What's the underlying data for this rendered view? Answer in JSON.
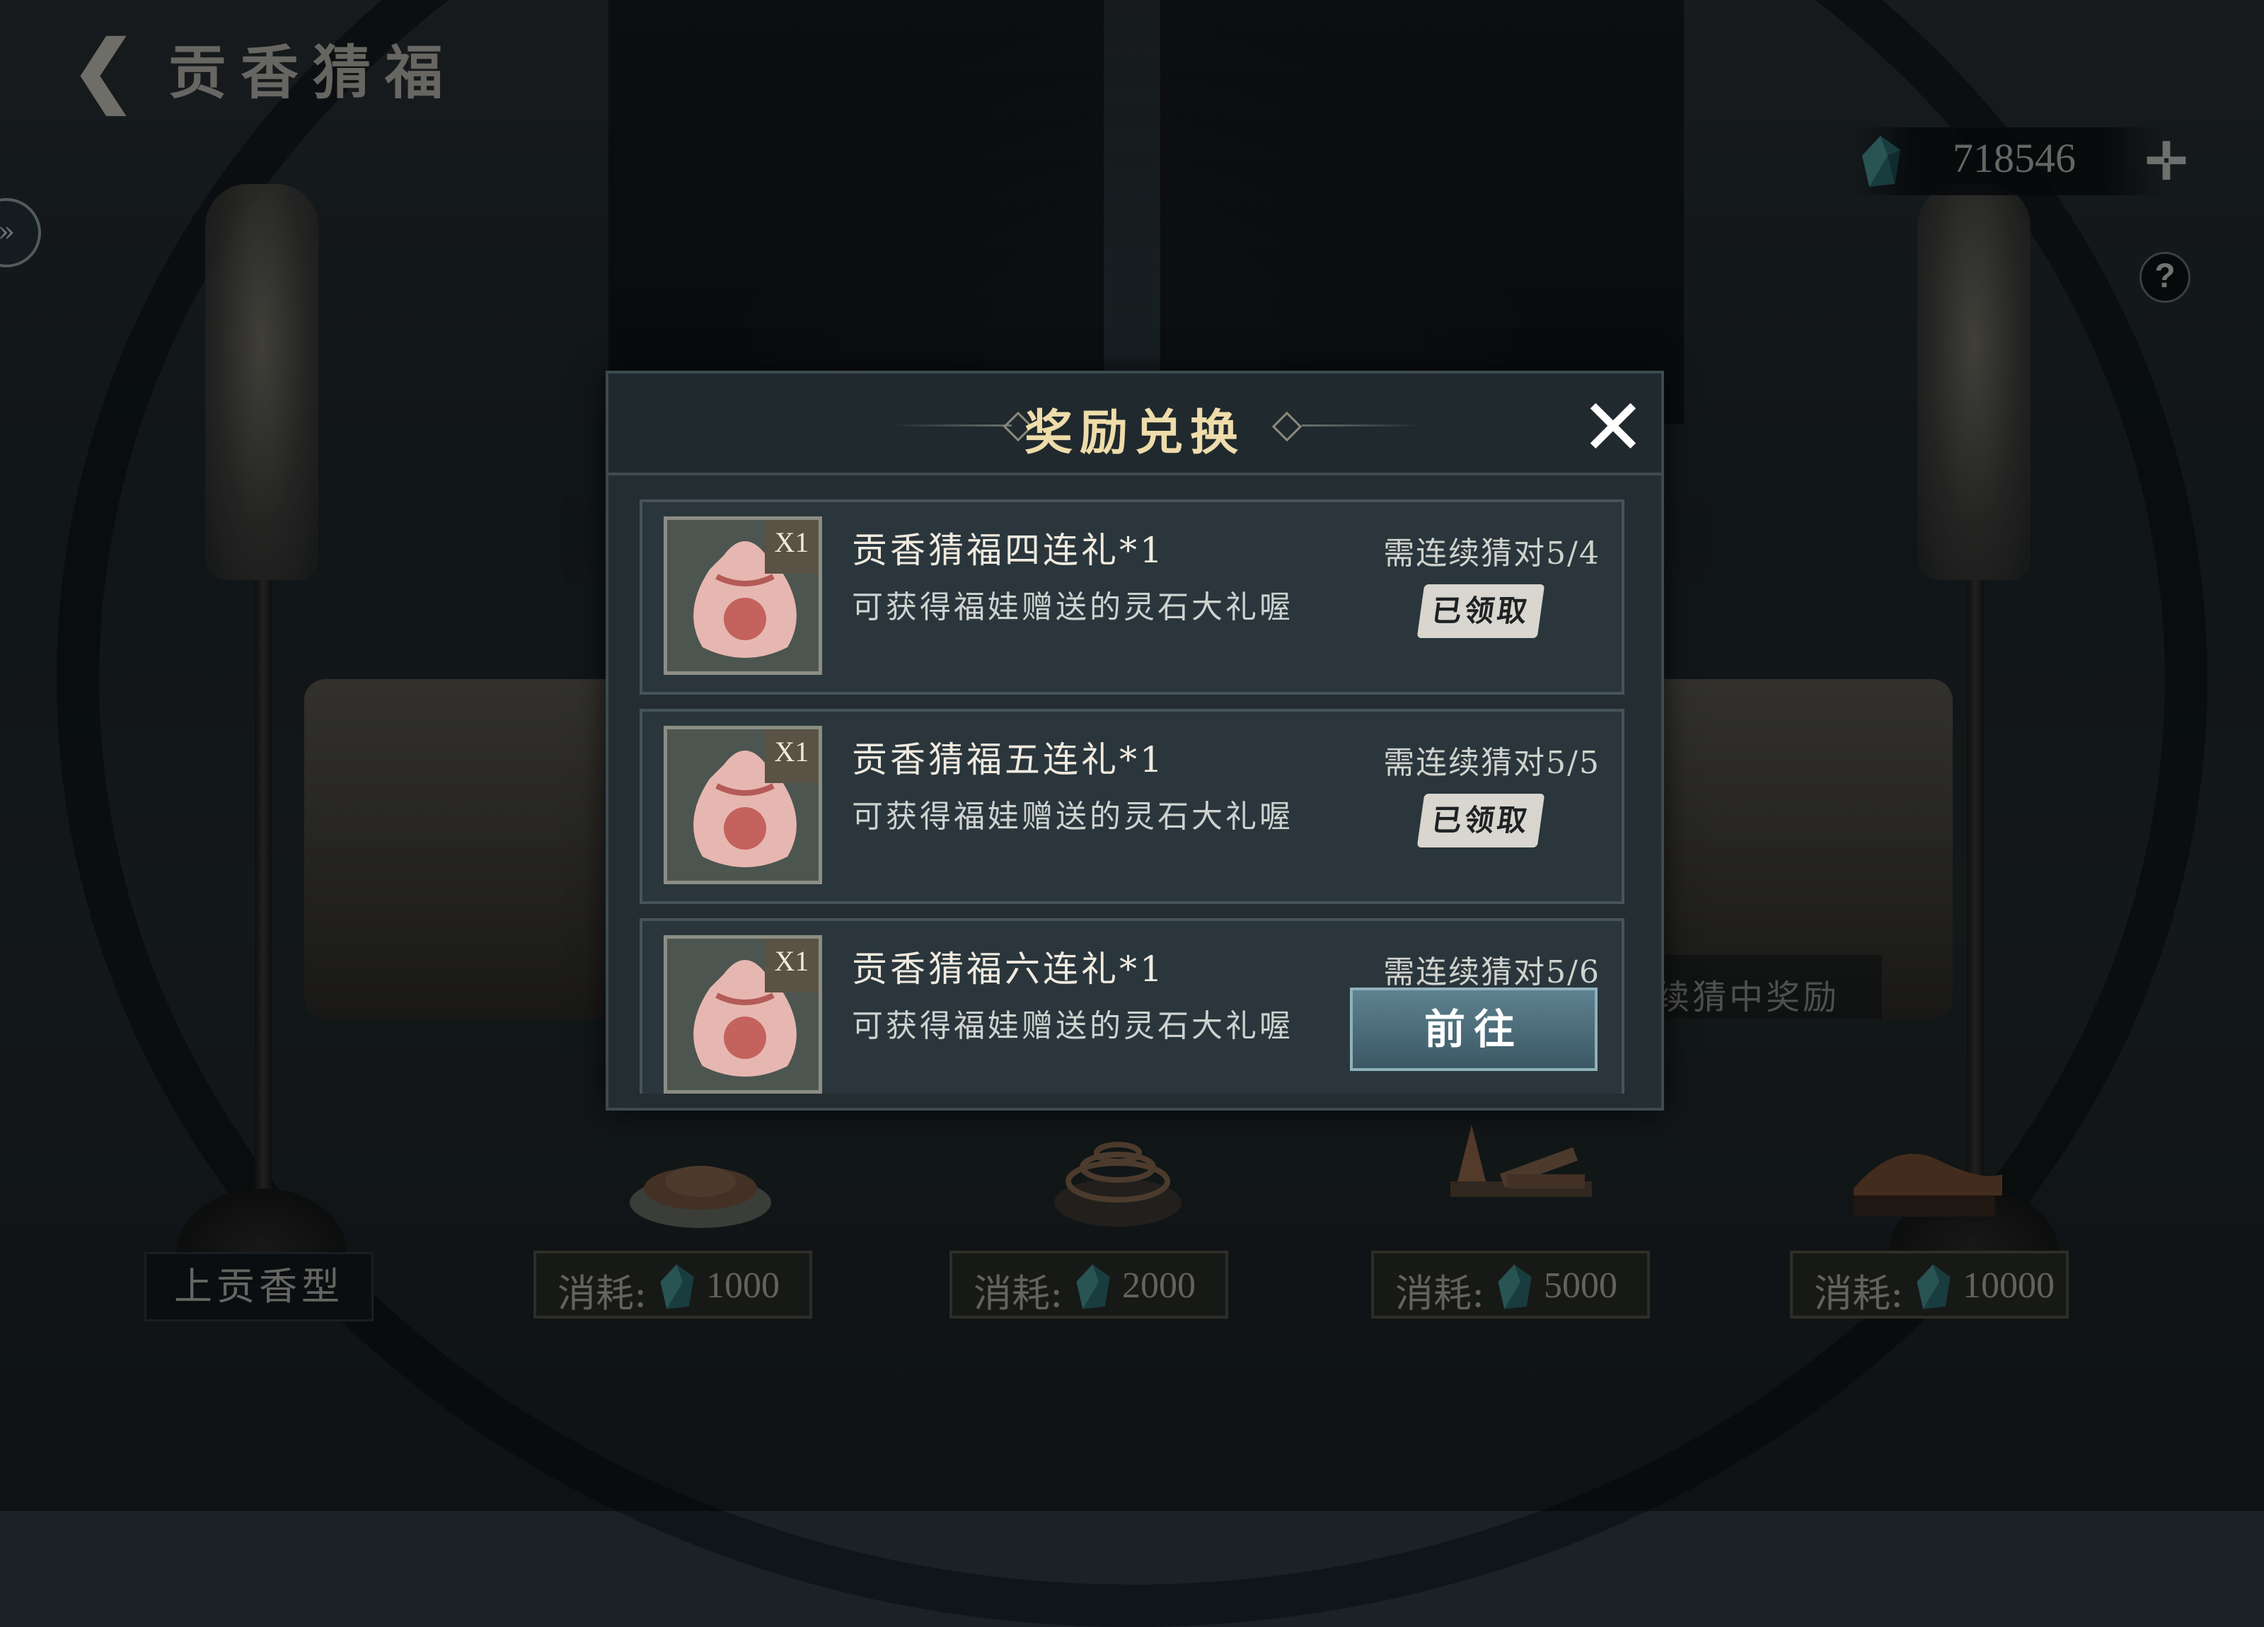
{
  "header": {
    "back_icon": "back-arrow-icon",
    "title": "贡香猜福"
  },
  "currency": {
    "icon": "spirit-stone-icon",
    "amount": "718546",
    "add_icon": "plus-icon"
  },
  "help": {
    "label": "?"
  },
  "background_hint": "续猜中奖励",
  "bottom": {
    "offer_label": "上贡香型",
    "costs": [
      {
        "label": "消耗:",
        "value": "1000"
      },
      {
        "label": "消耗:",
        "value": "2000"
      },
      {
        "label": "消耗:",
        "value": "5000"
      },
      {
        "label": "消耗:",
        "value": "10000"
      }
    ]
  },
  "modal": {
    "title": "奖励兑换",
    "close_icon": "close-icon",
    "rewards": [
      {
        "name": "贡香猜福四连礼*1",
        "desc": "可获得福娃赠送的灵石大礼喔",
        "requirement": "需连续猜对5/4",
        "qty": "X1",
        "status": "已领取"
      },
      {
        "name": "贡香猜福五连礼*1",
        "desc": "可获得福娃赠送的灵石大礼喔",
        "requirement": "需连续猜对5/5",
        "qty": "X1",
        "status": "已领取"
      },
      {
        "name": "贡香猜福六连礼*1",
        "desc": "可获得福娃赠送的灵石大礼喔",
        "requirement": "需连续猜对5/6",
        "qty": "X1",
        "action": "前往"
      }
    ]
  },
  "colors": {
    "title_gold": "#eedcaa",
    "modal_bg": "#232d32",
    "go_button": "#4b6c78"
  }
}
